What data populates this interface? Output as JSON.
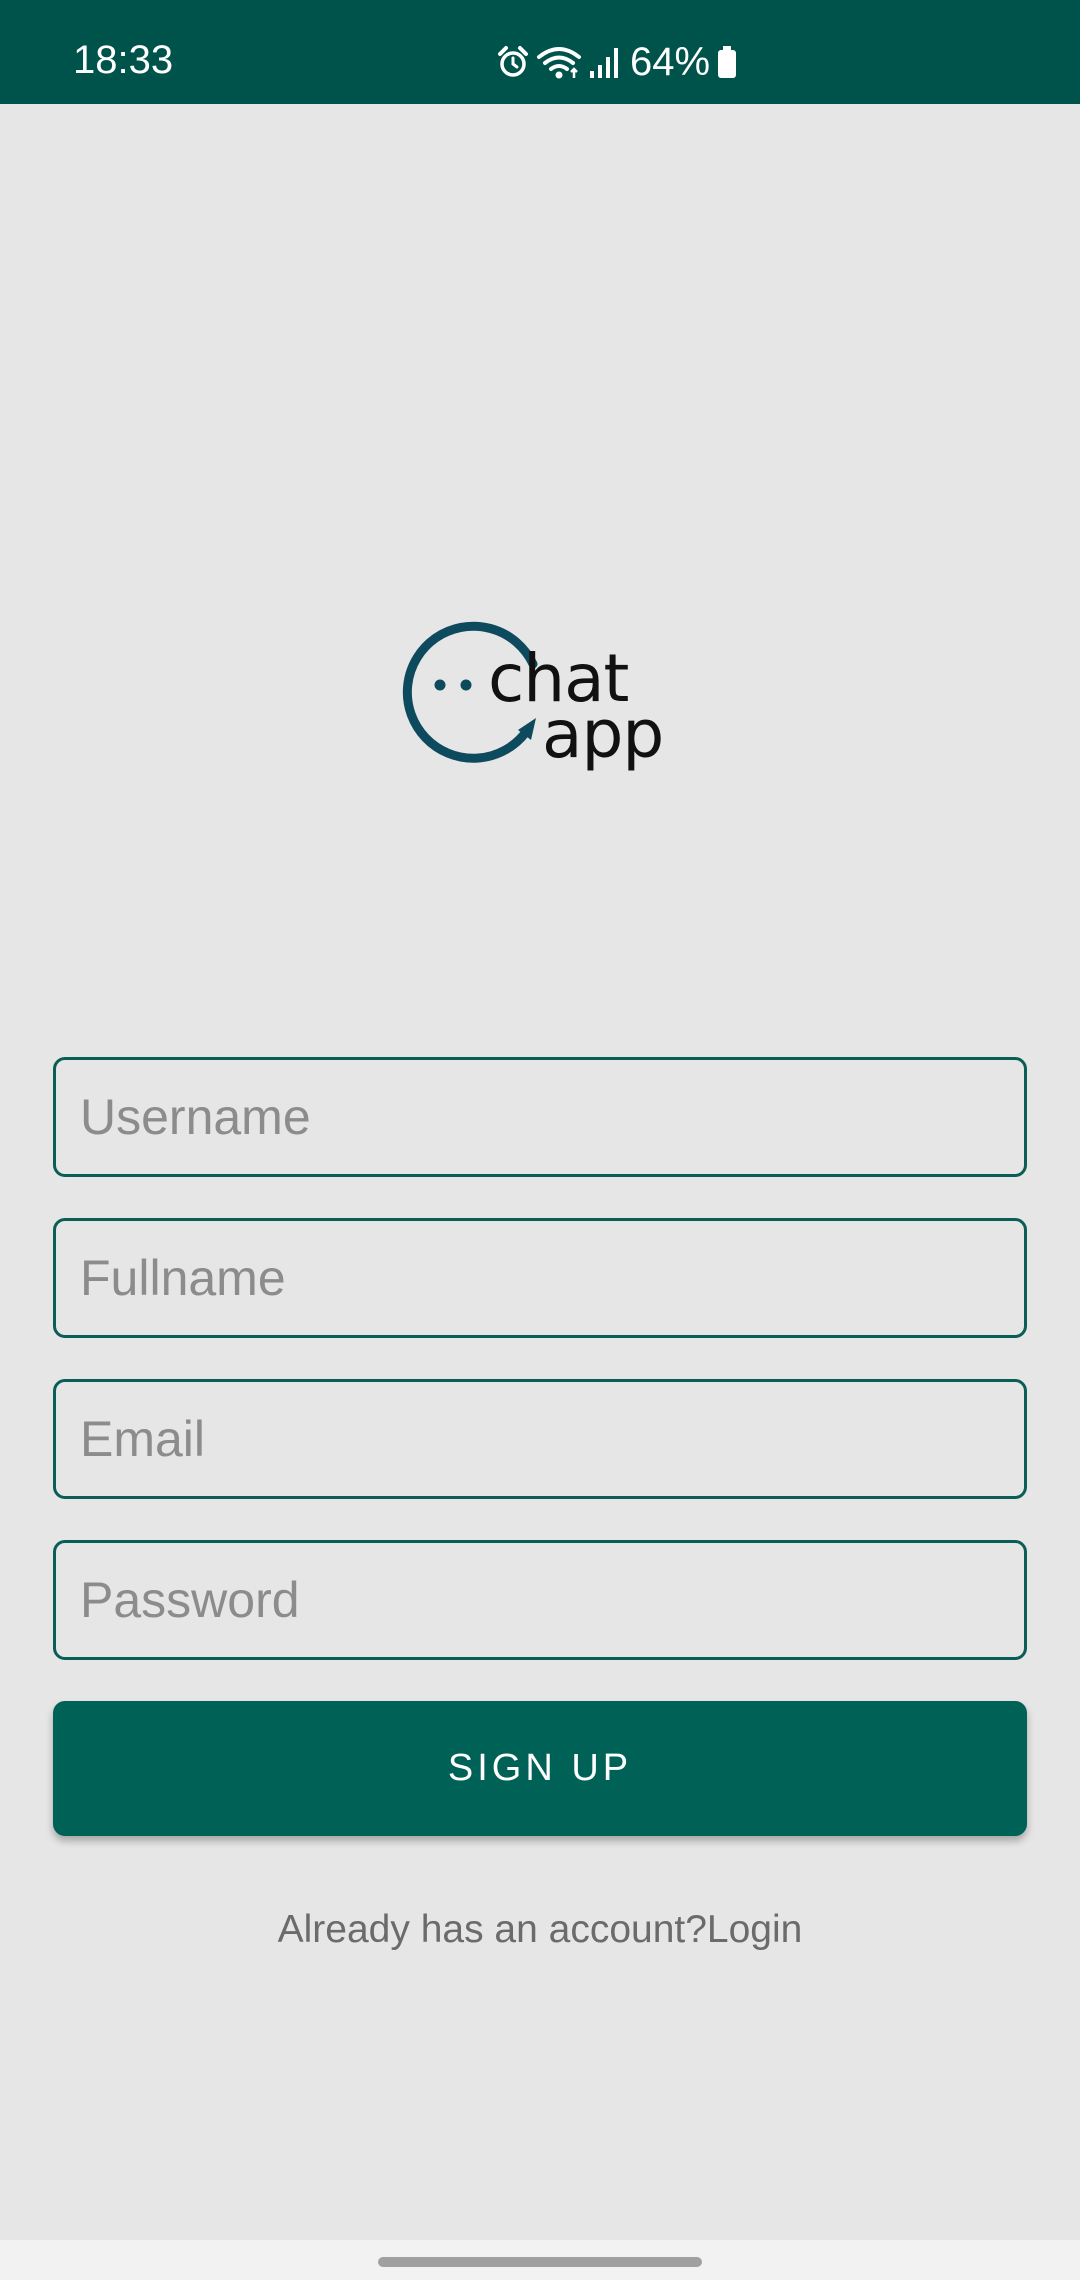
{
  "status_bar": {
    "time": "18:33",
    "battery": "64%",
    "icons": [
      "alarm-icon",
      "wifi-icon",
      "signal-icon",
      "battery-icon"
    ],
    "background": "#00534a"
  },
  "logo": {
    "line1": "chat",
    "line2": "app",
    "accent": "#0d4a5e"
  },
  "form": {
    "username_placeholder": "Username",
    "fullname_placeholder": "Fullname",
    "email_placeholder": "Email",
    "password_placeholder": "Password",
    "border_color": "#0b5e55"
  },
  "signup_button": {
    "label": "SIGN UP",
    "color": "#006156"
  },
  "login": {
    "prompt": "Already has an account?",
    "link": "Login"
  }
}
